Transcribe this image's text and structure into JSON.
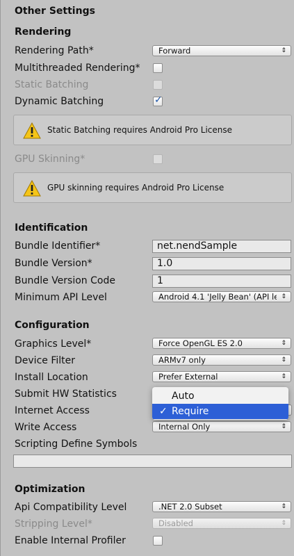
{
  "panel": {
    "title": "Other Settings"
  },
  "rendering": {
    "heading": "Rendering",
    "rendering_path": {
      "label": "Rendering Path*",
      "value": "Forward"
    },
    "multithreaded": {
      "label": "Multithreaded Rendering*",
      "checked": false
    },
    "static_batching": {
      "label": "Static Batching",
      "checked": false,
      "disabled": true
    },
    "dynamic_batching": {
      "label": "Dynamic Batching",
      "checked": true
    },
    "static_batching_warning": "Static Batching requires Android Pro License",
    "gpu_skinning": {
      "label": "GPU Skinning*",
      "checked": false,
      "disabled": true
    },
    "gpu_skinning_warning": "GPU skinning requires Android Pro License"
  },
  "identification": {
    "heading": "Identification",
    "bundle_identifier": {
      "label": "Bundle Identifier*",
      "value": "net.nendSample"
    },
    "bundle_version": {
      "label": "Bundle Version*",
      "value": "1.0"
    },
    "bundle_version_code": {
      "label": "Bundle Version Code",
      "value": "1"
    },
    "min_api_level": {
      "label": "Minimum API Level",
      "value": "Android 4.1 'Jelly Bean' (API le"
    }
  },
  "configuration": {
    "heading": "Configuration",
    "graphics_level": {
      "label": "Graphics Level*",
      "value": "Force OpenGL ES 2.0"
    },
    "device_filter": {
      "label": "Device Filter",
      "value": "ARMv7 only"
    },
    "install_location": {
      "label": "Install Location",
      "value": "Prefer External"
    },
    "submit_hw_stats": {
      "label": "Submit HW Statistics"
    },
    "internet_access": {
      "label": "Internet Access"
    },
    "write_access": {
      "label": "Write Access",
      "value": "Internal Only"
    },
    "scripting_define_symbols": {
      "label": "Scripting Define Symbols",
      "value": ""
    },
    "open_menu": {
      "items": [
        {
          "label": "Auto",
          "selected": false
        },
        {
          "label": "Require",
          "selected": true,
          "check": "✓"
        }
      ]
    }
  },
  "optimization": {
    "heading": "Optimization",
    "api_compat": {
      "label": "Api Compatibility Level",
      "value": ".NET 2.0 Subset"
    },
    "stripping_level": {
      "label": "Stripping Level*",
      "value": "Disabled",
      "disabled": true
    },
    "internal_profiler": {
      "label": "Enable Internal Profiler",
      "checked": false
    }
  },
  "icons": {
    "dropdown_arrow": "⇕",
    "checkmark": "✓"
  },
  "colors": {
    "panel_bg": "#c2c2c2",
    "menu_highlight": "#2d5fd6",
    "check_color": "#1e56a8"
  }
}
